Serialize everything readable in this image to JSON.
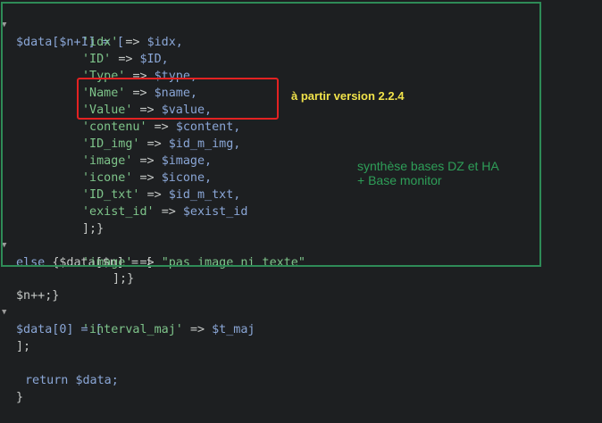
{
  "code": {
    "l1": "$data[$n+1] = [",
    "l2_key": "'idx'",
    "l2_val": "$idx,",
    "l3_key": "'ID'",
    "l3_val": "$ID,",
    "l4_key": "'Type'",
    "l4_val": "$type,",
    "l5_key": "'Name'",
    "l5_val": "$name,",
    "l6_key": "'Value'",
    "l6_val": "$value,",
    "l7_key": "'contenu'",
    "l7_val": "$content,",
    "l8_key": "'ID_img'",
    "l8_val": "$id_m_img,",
    "l9_key": "'image'",
    "l9_val": "$image,",
    "l10_key": "'icone'",
    "l10_val": "$icone,",
    "l11_key": "'ID_txt'",
    "l11_val": "$id_m_txt,",
    "l12_key": "'exist_id'",
    "l12_val": "$exist_id",
    "l13": "];}",
    "l14_kw": "else",
    "l14_rest": "{$data[$n] = [",
    "l15_key": "'image'",
    "l15_val": "\"pas image ni texte\"",
    "l16": "];}",
    "l17": "$n++;}",
    "l18": "$data[0] = [",
    "l19_key": "'interval_maj'",
    "l19_val": "$t_maj",
    "l20": "];",
    "l21_kw": "return",
    "l21_rest": "$data;",
    "l22": "}",
    "arrow": "=>"
  },
  "annotations": {
    "version_note": "à partir version 2.2.4",
    "synth_line1": "synthèse  bases DZ et HA",
    "synth_line2": "+ Base monitor"
  },
  "colors": {
    "background": "#1d1f21",
    "string": "#7ec48a",
    "variable": "#8aa6d6",
    "frame_green": "#2e8b57",
    "box_red": "#e32222",
    "note_yellow": "#f0e24a"
  }
}
